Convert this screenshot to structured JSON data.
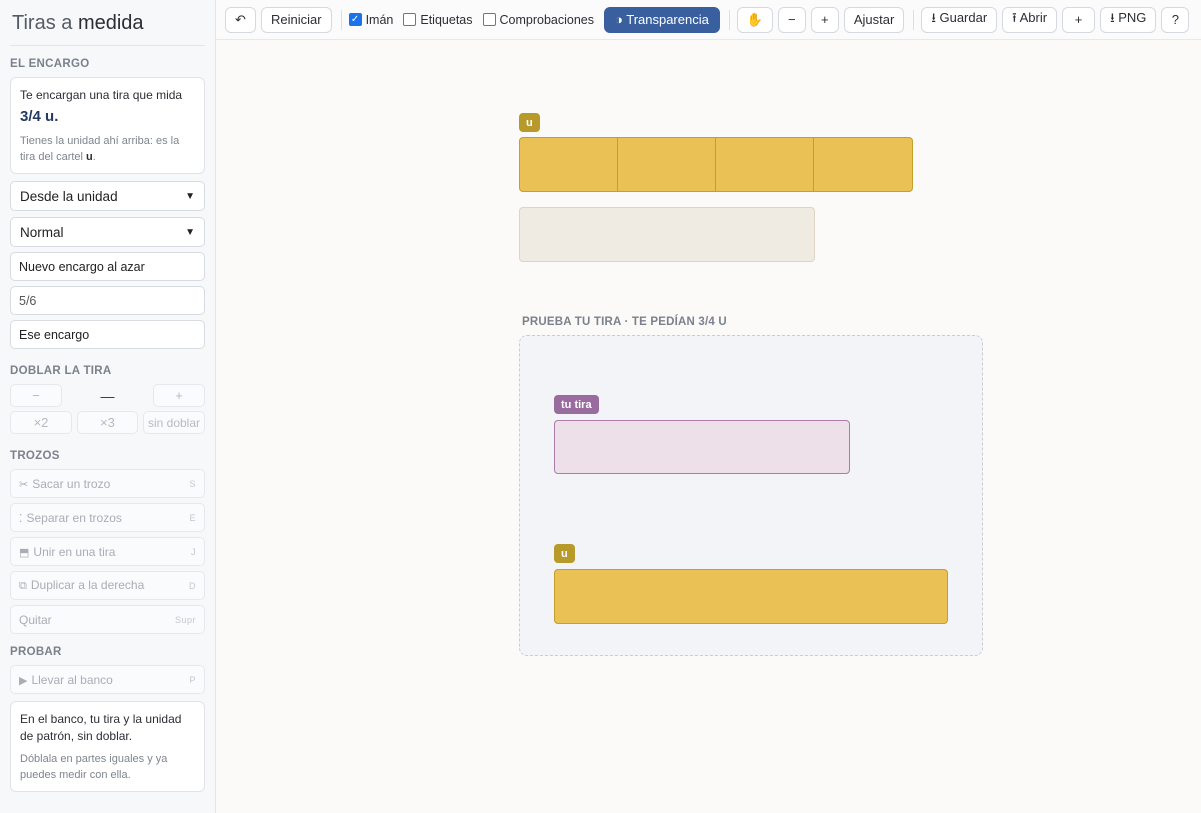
{
  "app": {
    "title_light": "Tiras a ",
    "title_bold": "medida"
  },
  "sidebar": {
    "encargo_heading": "EL ENCARGO",
    "encargo_card": {
      "text": "Te encargan una tira que mida",
      "amount_value": "3/4",
      "amount_unit": "u",
      "amount_end": ".",
      "hint": "Tienes la unidad ahí arriba: es la tira del cartel ",
      "hint_bold": "u",
      "hint_end": "."
    },
    "mode_select": "Desde la unidad",
    "level_select": "Normal",
    "random_button": "Nuevo encargo al azar",
    "fraction_input": {
      "value": "5/6"
    },
    "set_button": "Ese encargo",
    "doblar_heading": "DOBLAR LA TIRA",
    "doblar": {
      "minus": "−",
      "value": "—",
      "plus": "+",
      "x2": "×2",
      "x3": "×3",
      "none": "sin doblar"
    },
    "trozos_heading": "TROZOS",
    "trozos": [
      {
        "icon": "✂",
        "label": "Sacar un trozo",
        "key": "S"
      },
      {
        "icon": "⁚",
        "label": "Separar en trozos",
        "key": "E"
      },
      {
        "icon": "⬒",
        "label": "Unir en una tira",
        "key": "J"
      },
      {
        "icon": "⧉",
        "label": "Duplicar a la derecha",
        "key": "D"
      },
      {
        "icon": "",
        "label": "Quitar",
        "key": "Supr"
      }
    ],
    "probar_heading": "PROBAR",
    "probar_button": {
      "icon": "▶",
      "label": "Llevar al banco",
      "key": "P"
    },
    "info_card": {
      "text": "En el banco, tu tira y la unidad de patrón, sin doblar.",
      "hint": "Dóblala en partes iguales y ya puedes medir con ella."
    }
  },
  "toolbar": {
    "undo": "↶",
    "reset": "Reiniciar",
    "iman": {
      "label": "Imán",
      "checked": true
    },
    "etiquetas": {
      "label": "Etiquetas",
      "checked": false
    },
    "comprobaciones": {
      "label": "Comprobaciones",
      "checked": false
    },
    "transparencia": "◑ Transparencia",
    "hand": "✋",
    "zoom_out": "−",
    "zoom_in": "+",
    "fit": "Ajustar",
    "save": "⭳ Guardar",
    "open": "⭱ Abrir",
    "add": "+",
    "png": "⭳ PNG",
    "help": "?"
  },
  "canvas": {
    "unit_tag": "u",
    "unit_segments": 4,
    "bench_title": "PRUEBA TU TIRA · TE PEDÍAN 3/4 U",
    "your_strip_tag": "tu tira",
    "bench_unit_tag": "u"
  },
  "colors": {
    "gold": "#e9c155",
    "gold_border": "#c39f2c",
    "purple": "#9a6b9e",
    "primary": "#3a5f9e"
  }
}
